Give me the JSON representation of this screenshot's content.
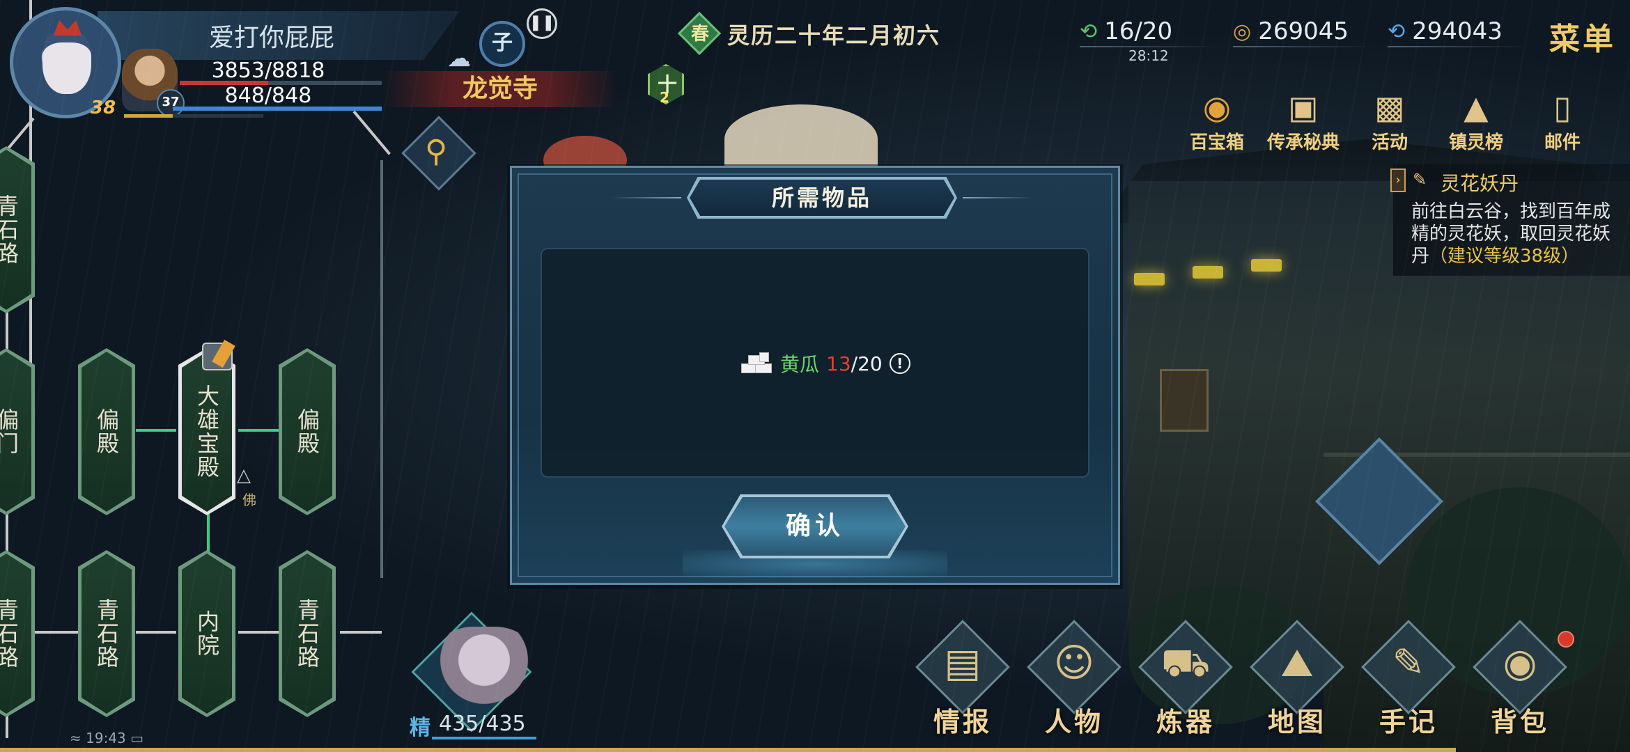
{
  "player": {
    "name": "爱打你屁屁",
    "level": "38",
    "pet_level": "37",
    "hp": "3853/8818",
    "hp_ratio": 0.437,
    "mp": "848/848",
    "mp_ratio": 1.0,
    "zodiac": "子",
    "location": "龙觉寺"
  },
  "calendar": {
    "season": "春",
    "date": "灵历二十年二月初六"
  },
  "buff": {
    "symbol": "十",
    "count": "2"
  },
  "resources": {
    "stamina": "16/20",
    "stamina_timer": "28:12",
    "coins": "269045",
    "jade": "294043"
  },
  "menu_label": "菜单",
  "functions": [
    {
      "label": "百宝箱",
      "icon": "treasure-chest-icon"
    },
    {
      "label": "传承秘典",
      "icon": "book-icon"
    },
    {
      "label": "活动",
      "icon": "gift-icon"
    },
    {
      "label": "镇灵榜",
      "icon": "pagoda-icon"
    },
    {
      "label": "邮件",
      "icon": "mail-icon"
    }
  ],
  "quest": {
    "title": "灵花妖丹",
    "desc": "前往白云谷，找到百年成精的灵花妖，取回灵花妖丹",
    "hint": "（建议等级38级）"
  },
  "map": {
    "nodes": {
      "left_top": "青石路",
      "left_mid": "偏门",
      "left_bottom": "青石路",
      "pianDian1": "偏殿",
      "daxiong": "大雄宝殿",
      "pianDian2": "偏殿",
      "qingshi1": "青石路",
      "neiyuan": "内院",
      "qingshi2": "青石路"
    },
    "buddha_tag": "佛"
  },
  "spirit": {
    "label": "精",
    "value": "435/435"
  },
  "status_time": "19:43",
  "bottom_menu": [
    {
      "label": "情报",
      "icon": "scroll-icon"
    },
    {
      "label": "人物",
      "icon": "character-icon"
    },
    {
      "label": "炼器",
      "icon": "cauldron-icon"
    },
    {
      "label": "地图",
      "icon": "mountain-map-icon"
    },
    {
      "label": "手记",
      "icon": "notes-icon"
    },
    {
      "label": "背包",
      "icon": "bag-icon"
    }
  ],
  "modal": {
    "title": "所需物品",
    "item_name": "黄瓜",
    "item_have": "13",
    "item_need": "/20",
    "confirm_label": "确认"
  },
  "colors": {
    "item_name": "#6fd46f",
    "item_have_insufficient": "#f23a2a",
    "gold": "#f0cb6a",
    "quest_hint": "#e8c445"
  }
}
